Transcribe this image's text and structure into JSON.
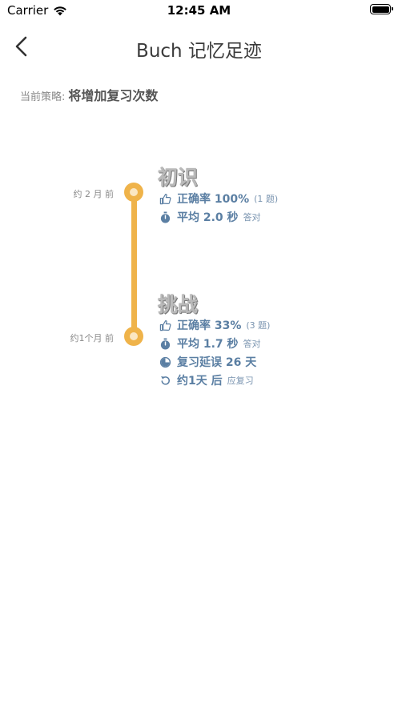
{
  "status_bar": {
    "carrier": "Carrier",
    "time": "12:45 AM"
  },
  "nav": {
    "title": "Buch 记忆足迹"
  },
  "strategy": {
    "label": "当前策略:",
    "value": "将增加复习次数"
  },
  "timeline": [
    {
      "time": "约 2 月 前",
      "title": "初识",
      "accuracy": "正确率 100%",
      "accuracy_note": "(1 题)",
      "avg_time": "平均 2.0 秒",
      "avg_note": "答对"
    },
    {
      "time": "约1个月 前",
      "title": "挑战",
      "accuracy": "正确率 33%",
      "accuracy_note": "(3 题)",
      "avg_time": "平均 1.7 秒",
      "avg_note": "答对",
      "delay": "复习延误 26 天",
      "next_review": "约1天 后",
      "next_note": "应复习"
    }
  ],
  "colors": {
    "accent": "#efb34a",
    "stat_text": "#5b7fa3"
  },
  "icons": [
    "wifi-icon",
    "battery-icon",
    "back-chevron-icon",
    "thumbs-up-icon",
    "stopwatch-icon",
    "clock-half-icon",
    "refresh-icon"
  ]
}
